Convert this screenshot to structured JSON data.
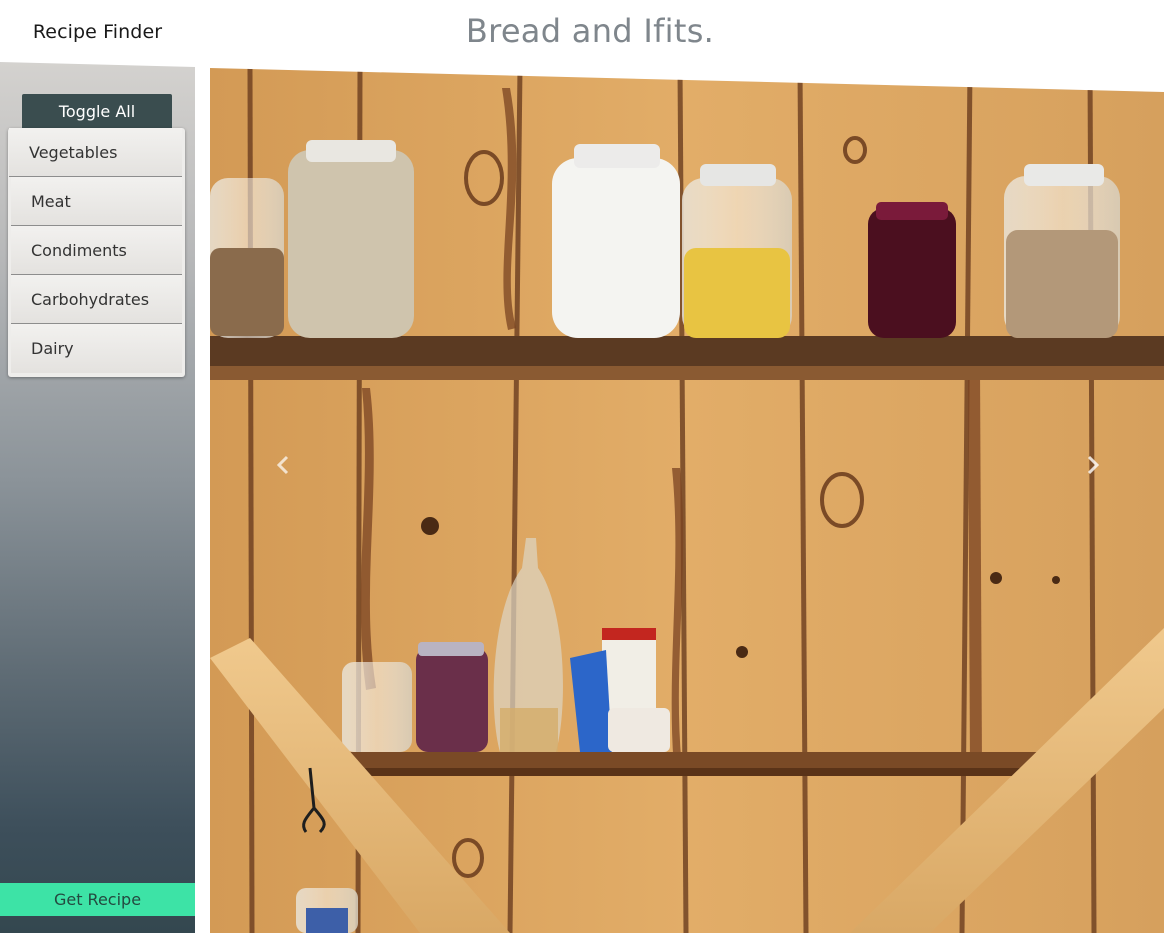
{
  "app": {
    "brand": "Recipe Finder"
  },
  "sidebar": {
    "toggle_label": "Toggle All",
    "categories": [
      {
        "label": "Vegetables"
      },
      {
        "label": "Meat"
      },
      {
        "label": "Condiments"
      },
      {
        "label": "Carbohydrates"
      },
      {
        "label": "Dairy"
      }
    ],
    "get_recipe_label": "Get Recipe"
  },
  "main": {
    "title": "Bread and Ifits.",
    "carousel": {
      "image_subject": "wooden pantry shelves with glass jars of grains, flour, cornmeal, jam, a glass oil jug and condiment jars",
      "prev_icon": "chevron-left-icon",
      "next_icon": "chevron-right-icon"
    }
  },
  "colors": {
    "toggle_bg": "#3a4d4f",
    "get_recipe_bg": "#3de3a6",
    "title_text": "#7f868c",
    "sidebar_top": "#d4d2cf",
    "sidebar_bottom": "#34474f",
    "wood": "#d9a45e"
  }
}
